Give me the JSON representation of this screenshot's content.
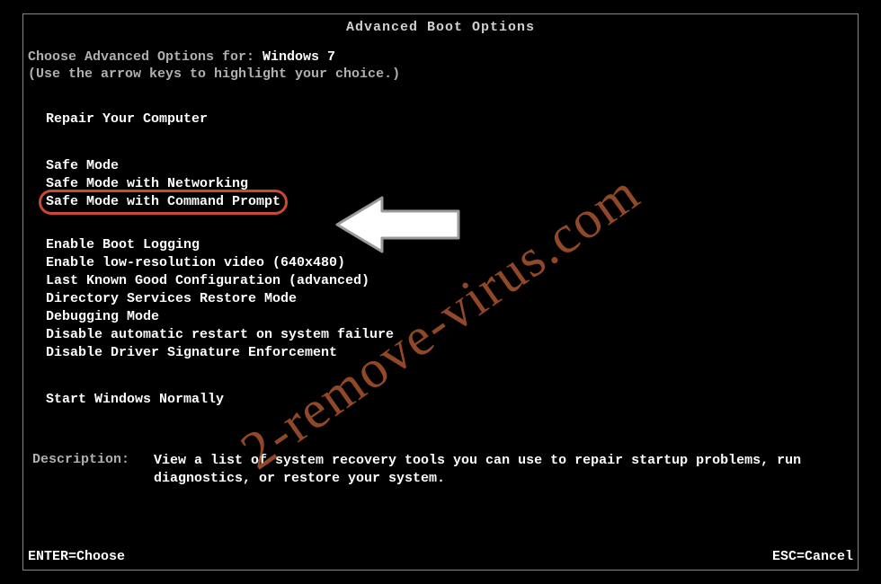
{
  "title": "Advanced Boot Options",
  "prompt_prefix": "Choose Advanced Options for: ",
  "os_name": "Windows 7",
  "hint": "(Use the arrow keys to highlight your choice.)",
  "group1": [
    "Repair Your Computer"
  ],
  "group2": [
    "Safe Mode",
    "Safe Mode with Networking",
    "Safe Mode with Command Prompt"
  ],
  "group3": [
    "Enable Boot Logging",
    "Enable low-resolution video (640x480)",
    "Last Known Good Configuration (advanced)",
    "Directory Services Restore Mode",
    "Debugging Mode",
    "Disable automatic restart on system failure",
    "Disable Driver Signature Enforcement"
  ],
  "group4": [
    "Start Windows Normally"
  ],
  "highlighted_option": "Safe Mode with Command Prompt",
  "description_label": "Description:",
  "description_text": "View a list of system recovery tools you can use to repair startup problems, run diagnostics, or restore your system.",
  "footer_left": "ENTER=Choose",
  "footer_right": "ESC=Cancel",
  "watermark": "2-remove-virus.com"
}
